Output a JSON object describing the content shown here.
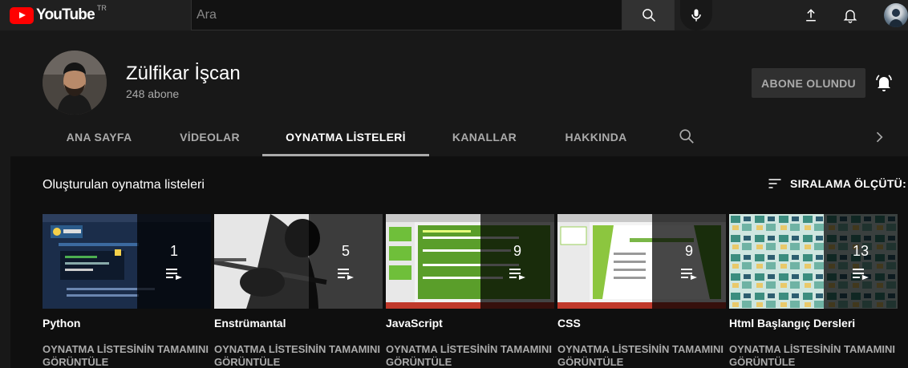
{
  "topbar": {
    "logo_text": "YouTube",
    "region": "TR",
    "search_placeholder": "Ara",
    "icons": [
      "search-icon",
      "mic-icon",
      "upload-icon",
      "bell-icon",
      "avatar"
    ]
  },
  "channel": {
    "name": "Zülfikar İşcan",
    "subscribers": "248 abone",
    "subscribe_button": "ABONE OLUNDU"
  },
  "tabs": [
    {
      "label": "ANA SAYFA",
      "active": false
    },
    {
      "label": "VİDEOLAR",
      "active": false
    },
    {
      "label": "OYNATMA LİSTELERİ",
      "active": true
    },
    {
      "label": "KANALLAR",
      "active": false
    },
    {
      "label": "HAKKINDA",
      "active": false
    }
  ],
  "section": {
    "title": "Oluşturulan oynatma listeleri",
    "sort_label": "SIRALAMA ÖLÇÜTÜ:"
  },
  "playlists": [
    {
      "title": "Python",
      "count": "1",
      "link": "OYNATMA LİSTESİNİN TAMAMINI GÖRÜNTÜLE"
    },
    {
      "title": "Enstrümantal",
      "count": "5",
      "link": "OYNATMA LİSTESİNİN TAMAMINI GÖRÜNTÜLE"
    },
    {
      "title": "JavaScript",
      "count": "9",
      "link": "OYNATMA LİSTESİNİN TAMAMINI GÖRÜNTÜLE"
    },
    {
      "title": "CSS",
      "count": "9",
      "link": "OYNATMA LİSTESİNİN TAMAMINI GÖRÜNTÜLE"
    },
    {
      "title": "Html Başlangıç Dersleri",
      "count": "13",
      "link": "OYNATMA LİSTESİNİN TAMAMINI GÖRÜNTÜLE"
    }
  ],
  "colors": {
    "background": "#181818",
    "topbar": "#202020",
    "content": "#0f0f0f",
    "brand_red": "#ff0000",
    "muted_text": "#aaaaaa"
  }
}
